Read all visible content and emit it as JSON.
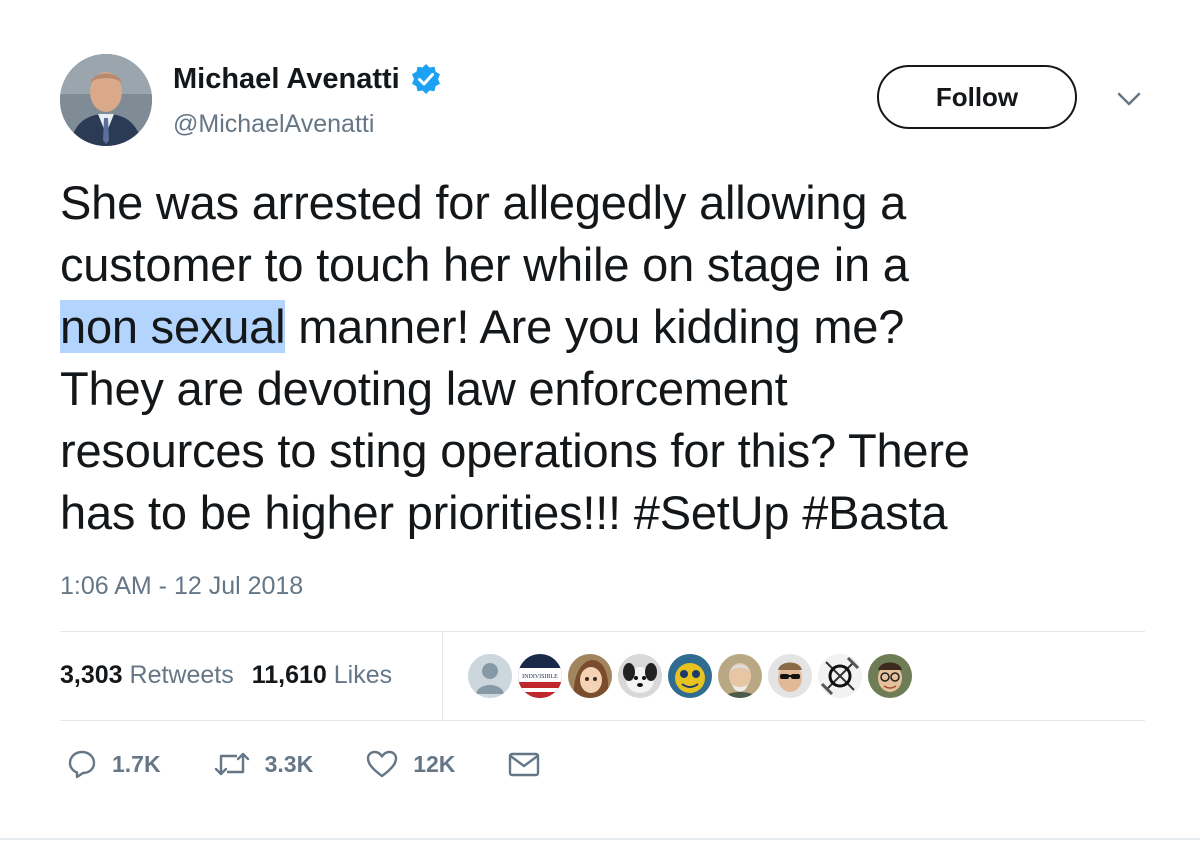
{
  "author": {
    "name": "Michael Avenatti",
    "handle": "@MichaelAvenatti",
    "verified": true
  },
  "follow_label": "Follow",
  "tweet": {
    "text_segments": {
      "l1": "She was arrested for allegedly allowing a",
      "l2": "customer to touch her while on stage in a",
      "l3_highlight": "non sexual",
      "l3_rest": " manner! Are you kidding me?",
      "l4": "They are devoting law enforcement",
      "l5": "resources to sting operations for this? There",
      "l6": "has to be higher priorities!!! #SetUp #Basta"
    },
    "timestamp": "1:06 AM - 12 Jul 2018"
  },
  "stats": {
    "retweets_count": "3,303",
    "retweets_label": "Retweets",
    "likes_count": "11,610",
    "likes_label": "Likes"
  },
  "liker_avatars": [
    "default-avatar",
    "indivisible-logo-avatar",
    "anime-girl-avatar",
    "dog-avatar",
    "mascot-avatar",
    "older-man-avatar",
    "sunglasses-man-avatar",
    "sketch-avatar",
    "glasses-man-avatar"
  ],
  "actions": {
    "reply_count": "1.7K",
    "retweet_count": "3.3K",
    "like_count": "12K"
  },
  "colors": {
    "text": "#14171a",
    "secondary": "#657786",
    "verified": "#1da1f2",
    "highlight": "#b3d4fc",
    "divider": "#e1e8ed"
  }
}
